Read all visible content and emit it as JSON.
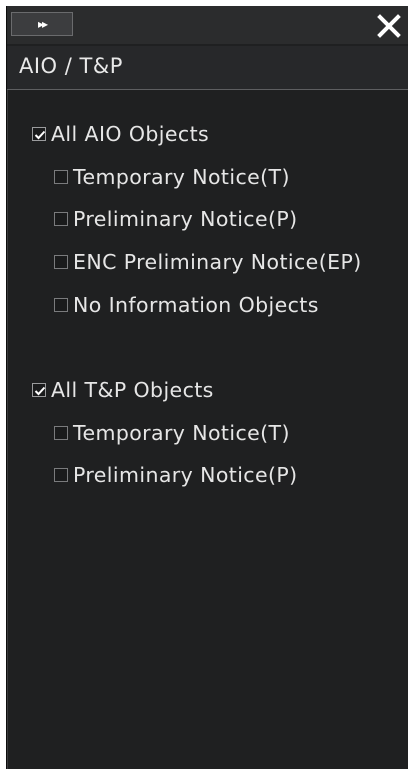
{
  "panel": {
    "collapse_glyph": "▸▸",
    "close_icon": "close-icon",
    "title": "AIO / T&P"
  },
  "groups": [
    {
      "label": "All AIO Objects",
      "checked": true,
      "items": [
        {
          "label": "Temporary Notice(T)",
          "checked": false
        },
        {
          "label": "Preliminary Notice(P)",
          "checked": false
        },
        {
          "label": "ENC Preliminary Notice(EP)",
          "checked": false
        },
        {
          "label": "No Information Objects",
          "checked": false
        }
      ]
    },
    {
      "label": "All T&P Objects",
      "checked": true,
      "items": [
        {
          "label": "Temporary Notice(T)",
          "checked": false
        },
        {
          "label": "Preliminary Notice(P)",
          "checked": false
        }
      ]
    }
  ],
  "colors": {
    "background": "#1f2021",
    "text": "#e6e6e6",
    "checkbox_border": "#7a7b7d"
  }
}
